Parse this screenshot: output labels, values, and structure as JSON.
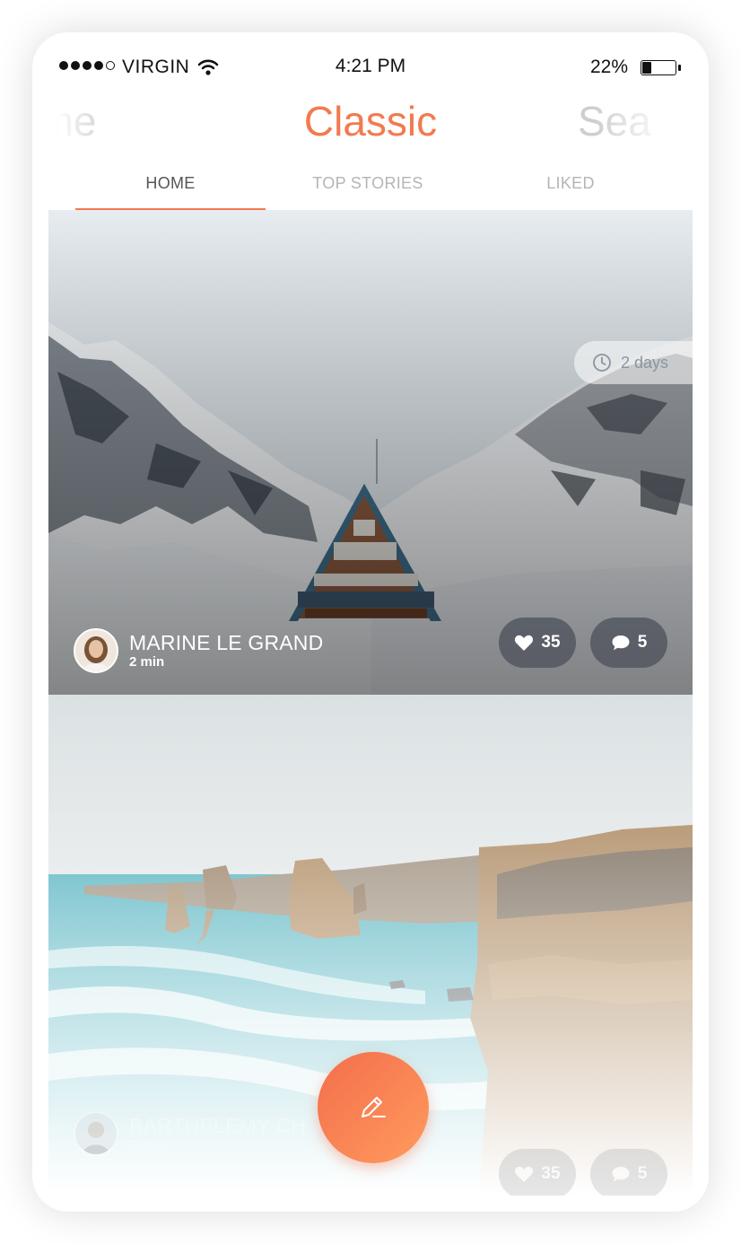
{
  "status_bar": {
    "carrier": "VIRGIN",
    "time": "4:21 PM",
    "battery_percent": "22%",
    "battery_level": 0.22,
    "signal_bars": 4,
    "signal_max": 5
  },
  "header": {
    "prev_title": "ome",
    "title": "Classic",
    "next_title": "Sea",
    "accent_color": "#f27a4f"
  },
  "tabs": [
    {
      "label": "HOME",
      "active": true
    },
    {
      "label": "TOP STORIES",
      "active": false
    },
    {
      "label": "LIKED",
      "active": false
    }
  ],
  "posts": [
    {
      "author": "MARINE LE GRAND",
      "read_time": "2 min",
      "age": "2 days",
      "likes": "35",
      "comments": "5",
      "photo": "snowy-mountains-a-frame-cabin"
    },
    {
      "author": "BARTHELEMY CH",
      "read_time": "2 min",
      "likes": "35",
      "comments": "5",
      "photo": "coastal-sea-stacks"
    }
  ],
  "fab": {
    "icon": "pencil-icon"
  }
}
